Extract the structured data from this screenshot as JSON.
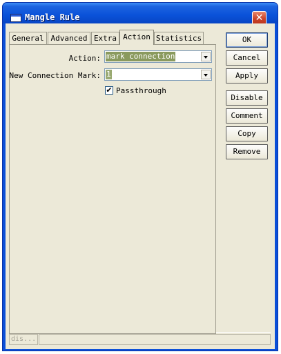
{
  "window": {
    "title": "Mangle Rule",
    "close_glyph": "✕"
  },
  "tabs": [
    {
      "label": "General",
      "active": false
    },
    {
      "label": "Advanced",
      "active": false
    },
    {
      "label": "Extra",
      "active": false
    },
    {
      "label": "Action",
      "active": true
    },
    {
      "label": "Statistics",
      "active": false
    }
  ],
  "form": {
    "action_label": "Action:",
    "action_value": "mark connection",
    "connection_mark_label": "New Connection Mark:",
    "connection_mark_value": "1",
    "passthrough_label": "Passthrough",
    "passthrough_checked": true,
    "check_glyph": "✔"
  },
  "buttons": {
    "ok": "OK",
    "cancel": "Cancel",
    "apply": "Apply",
    "disable": "Disable",
    "comment": "Comment",
    "copy": "Copy",
    "remove": "Remove"
  },
  "status": {
    "text": "dis..."
  },
  "icons": {
    "window": "window-app-icon",
    "close": "close-icon",
    "dropdown": "chevron-down-icon",
    "check": "checkmark-icon"
  }
}
